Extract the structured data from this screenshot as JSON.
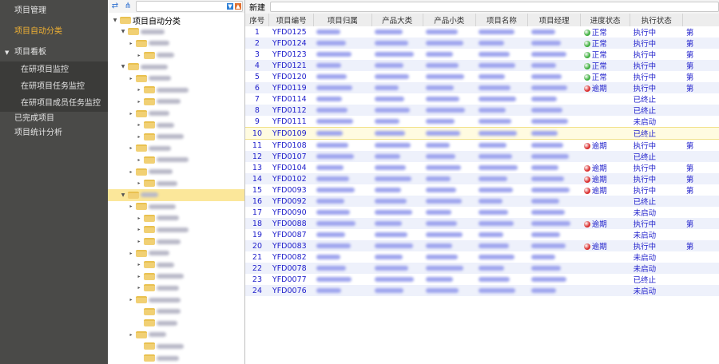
{
  "sidebar": {
    "items": [
      {
        "label": "项目管理"
      },
      {
        "label": "项目自动分类",
        "active": true
      },
      {
        "label": "项目看板"
      }
    ],
    "sub": [
      {
        "label": "在研项目监控"
      },
      {
        "label": "在研项目任务监控"
      },
      {
        "label": "在研项目成员任务监控"
      }
    ],
    "after": [
      {
        "label": "已完成项目"
      },
      {
        "label": "项目统计分析"
      }
    ]
  },
  "tree": {
    "root": "项目自动分类",
    "levels": [
      1,
      2,
      3,
      1,
      2,
      3,
      3,
      2,
      3,
      3,
      2,
      3,
      2,
      3,
      1,
      2,
      3,
      3,
      3,
      2,
      3,
      3,
      3,
      2,
      3,
      3,
      2,
      3,
      3
    ],
    "selected_index": 14
  },
  "grid": {
    "new_label": "新建",
    "columns": [
      "序号",
      "项目编号",
      "项目归属",
      "产品大类",
      "产品小类",
      "项目名称",
      "项目经理",
      "进度状态",
      "执行状态",
      ""
    ],
    "rows": [
      {
        "no": "1",
        "id": "YFD0125",
        "progress": "正常",
        "exec": "执行中",
        "extra": "第"
      },
      {
        "no": "2",
        "id": "YFD0124",
        "progress": "正常",
        "exec": "执行中",
        "extra": "第"
      },
      {
        "no": "3",
        "id": "YFD0123",
        "progress": "正常",
        "exec": "执行中",
        "extra": "第"
      },
      {
        "no": "4",
        "id": "YFD0121",
        "progress": "正常",
        "exec": "执行中",
        "extra": "第"
      },
      {
        "no": "5",
        "id": "YFD0120",
        "progress": "正常",
        "exec": "执行中",
        "extra": "第"
      },
      {
        "no": "6",
        "id": "YFD0119",
        "progress": "逾期",
        "exec": "执行中",
        "extra": "第"
      },
      {
        "no": "7",
        "id": "YFD0114",
        "progress": "",
        "exec": "已终止",
        "extra": ""
      },
      {
        "no": "8",
        "id": "YFD0112",
        "progress": "",
        "exec": "已终止",
        "extra": ""
      },
      {
        "no": "9",
        "id": "YFD0111",
        "progress": "",
        "exec": "未启动",
        "extra": ""
      },
      {
        "no": "10",
        "id": "YFD0109",
        "progress": "",
        "exec": "已终止",
        "extra": ""
      },
      {
        "no": "11",
        "id": "YFD0108",
        "progress": "逾期",
        "exec": "执行中",
        "extra": "第"
      },
      {
        "no": "12",
        "id": "YFD0107",
        "progress": "",
        "exec": "已终止",
        "extra": ""
      },
      {
        "no": "13",
        "id": "YFD0104",
        "progress": "逾期",
        "exec": "执行中",
        "extra": "第"
      },
      {
        "no": "14",
        "id": "YFD0102",
        "progress": "逾期",
        "exec": "执行中",
        "extra": "第"
      },
      {
        "no": "15",
        "id": "YFD0093",
        "progress": "逾期",
        "exec": "执行中",
        "extra": "第"
      },
      {
        "no": "16",
        "id": "YFD0092",
        "progress": "",
        "exec": "已终止",
        "extra": ""
      },
      {
        "no": "17",
        "id": "YFD0090",
        "progress": "",
        "exec": "未启动",
        "extra": ""
      },
      {
        "no": "18",
        "id": "YFD0088",
        "progress": "逾期",
        "exec": "执行中",
        "extra": "第"
      },
      {
        "no": "19",
        "id": "YFD0087",
        "progress": "",
        "exec": "未启动",
        "extra": ""
      },
      {
        "no": "20",
        "id": "YFD0083",
        "progress": "逾期",
        "exec": "执行中",
        "extra": "第"
      },
      {
        "no": "21",
        "id": "YFD0082",
        "progress": "",
        "exec": "未启动",
        "extra": ""
      },
      {
        "no": "22",
        "id": "YFD0078",
        "progress": "",
        "exec": "未启动",
        "extra": ""
      },
      {
        "no": "23",
        "id": "YFD0077",
        "progress": "",
        "exec": "已终止",
        "extra": ""
      },
      {
        "no": "24",
        "id": "YFD0076",
        "progress": "",
        "exec": "未启动",
        "extra": ""
      }
    ],
    "selected_row": 10,
    "colors": {
      "normal": "#3cae3c",
      "overdue": "#d92b2b",
      "link": "#2222cc"
    }
  }
}
